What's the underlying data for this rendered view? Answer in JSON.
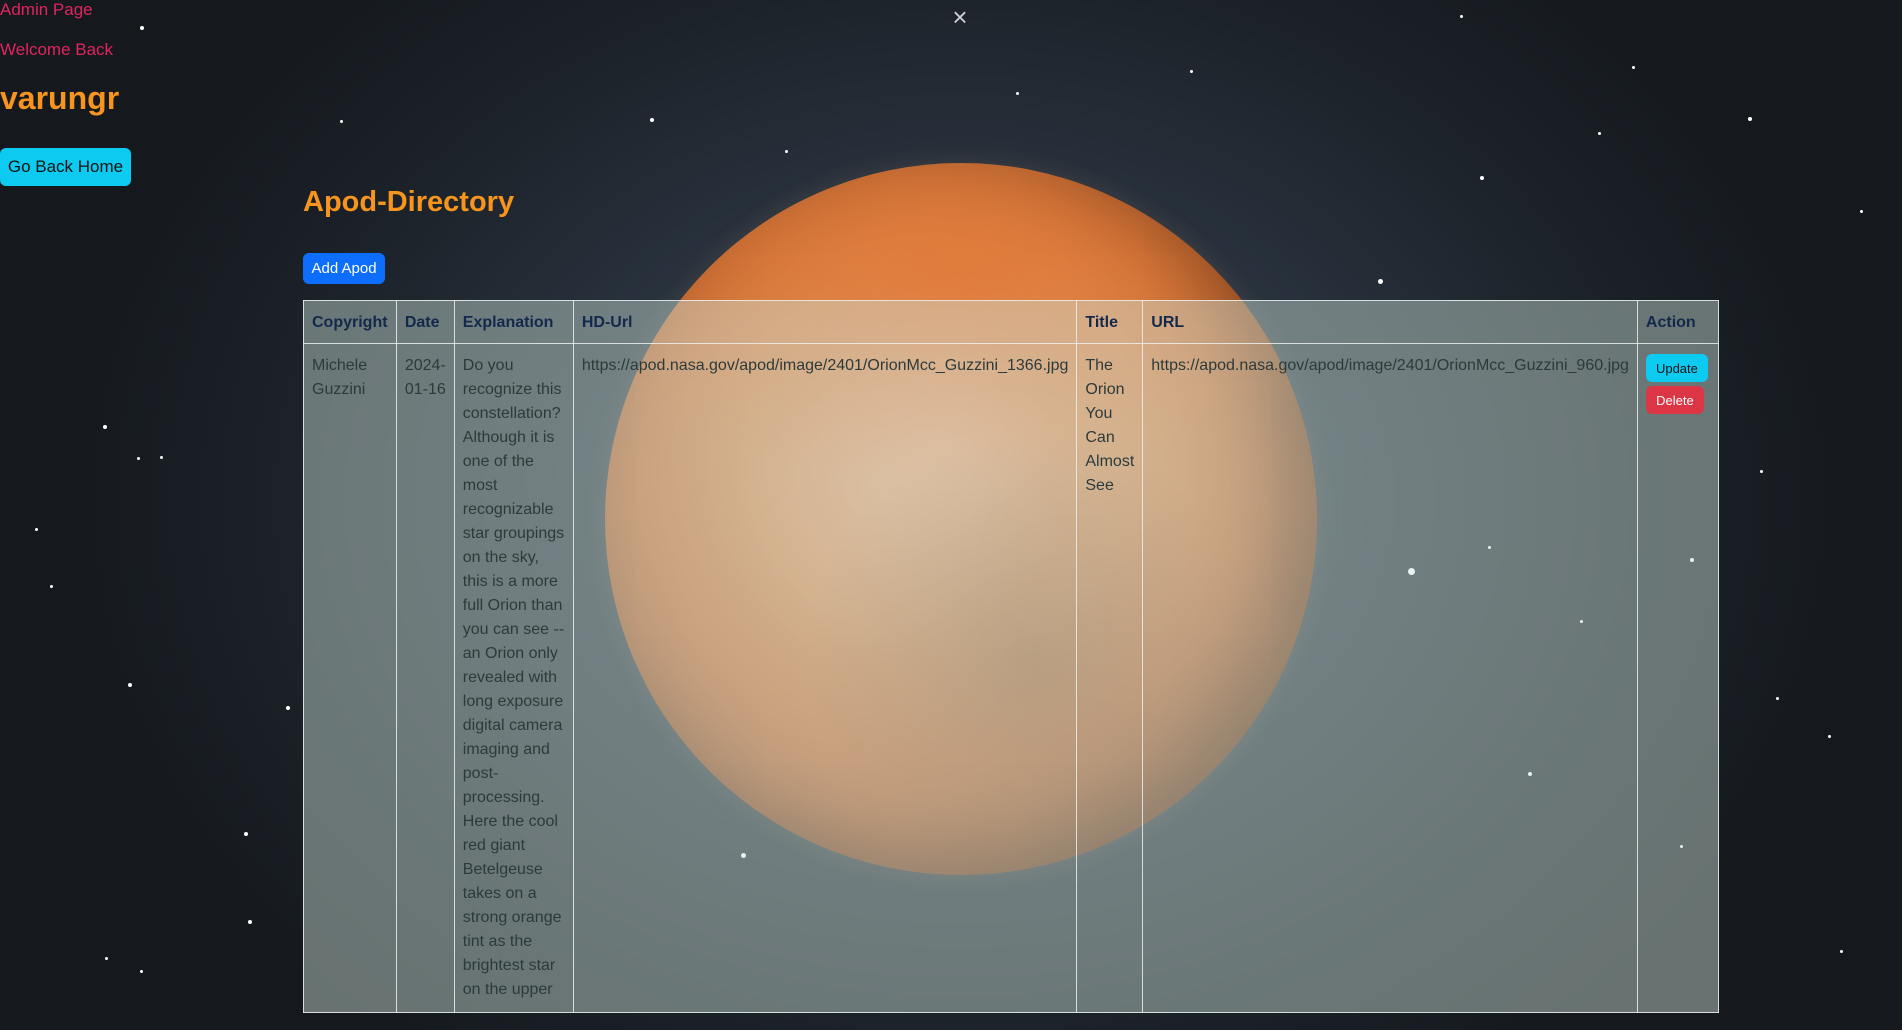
{
  "header": {
    "admin_label": "Admin Page",
    "welcome_label": "Welcome Back",
    "username": "varungr",
    "home_button": "Go Back Home",
    "close_glyph": "×"
  },
  "main": {
    "title": "Apod-Directory",
    "add_button": "Add Apod"
  },
  "table": {
    "columns": [
      "Copyright",
      "Date",
      "Explanation",
      "HD-Url",
      "Title",
      "URL",
      "Action"
    ],
    "rows": [
      {
        "copyright": "Michele Guzzini",
        "date": "2024-01-16",
        "explanation": "Do you recognize this constellation? Although it is one of the most recognizable star groupings on the sky, this is a more full Orion than you can see -- an Orion only revealed with long exposure digital camera imaging and post-processing. Here the cool red giant Betelgeuse takes on a strong orange tint as the brightest star on the upper",
        "hdurl": "https://apod.nasa.gov/apod/image/2401/OrionMcc_Guzzini_1366.jpg",
        "title": "The Orion You Can Almost See",
        "url": "https://apod.nasa.gov/apod/image/2401/OrionMcc_Guzzini_960.jpg",
        "update_label": "Update",
        "delete_label": "Delete"
      }
    ]
  },
  "colors": {
    "accent_orange": "#f7941d",
    "accent_pink": "#e0245e",
    "info_cyan": "#0dcaf0",
    "primary_blue": "#0d6efd",
    "danger_red": "#dc3545"
  },
  "icons": {
    "close": "close-icon",
    "background": "planet-image"
  }
}
